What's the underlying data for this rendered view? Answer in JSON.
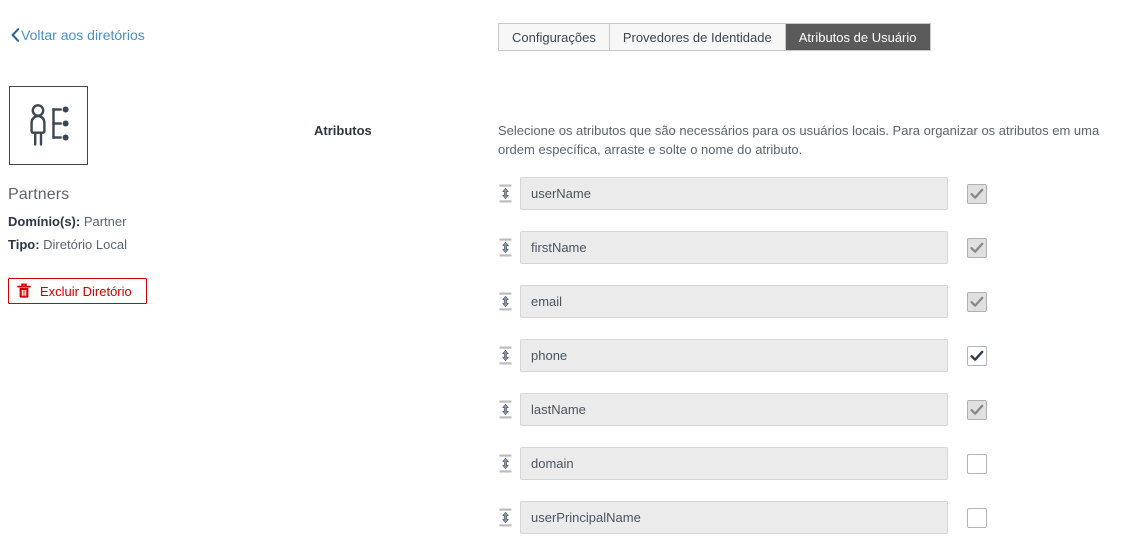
{
  "sidebar": {
    "back_link": "Voltar aos diretórios",
    "back_icon": "chevron-left-icon",
    "directory_icon": "user-directory-icon",
    "directory_name": "Partners",
    "meta": {
      "domain_label": "Domínio(s):",
      "domain_value": "Partner",
      "type_label": "Tipo:",
      "type_value": "Diretório Local"
    },
    "delete_button": {
      "label": "Excluir Diretório",
      "icon": "trash-icon",
      "color": "#cc0000"
    }
  },
  "tabs": [
    {
      "label": "Configurações",
      "active": false
    },
    {
      "label": "Provedores de Identidade",
      "active": false
    },
    {
      "label": "Atributos de Usuário",
      "active": true
    }
  ],
  "form": {
    "section_label": "Atributos",
    "description": "Selecione os atributos que são necessários para os usuários locais. Para organizar os atributos em uma ordem específica, arraste e solte o nome do atributo.",
    "drag_icon": "drag-vertical-icon",
    "check_icon": "checkmark-icon",
    "attributes": [
      {
        "name": "userName",
        "checked": true,
        "locked": true
      },
      {
        "name": "firstName",
        "checked": true,
        "locked": true
      },
      {
        "name": "email",
        "checked": true,
        "locked": true
      },
      {
        "name": "phone",
        "checked": true,
        "locked": false
      },
      {
        "name": "lastName",
        "checked": true,
        "locked": true
      },
      {
        "name": "domain",
        "checked": false,
        "locked": false
      },
      {
        "name": "userPrincipalName",
        "checked": false,
        "locked": false
      }
    ]
  },
  "colors": {
    "link": "#4a90c4",
    "active_tab_bg": "#5a5a5a",
    "danger": "#cc0000",
    "text": "#3c4650",
    "input_bg": "#ebebeb"
  }
}
